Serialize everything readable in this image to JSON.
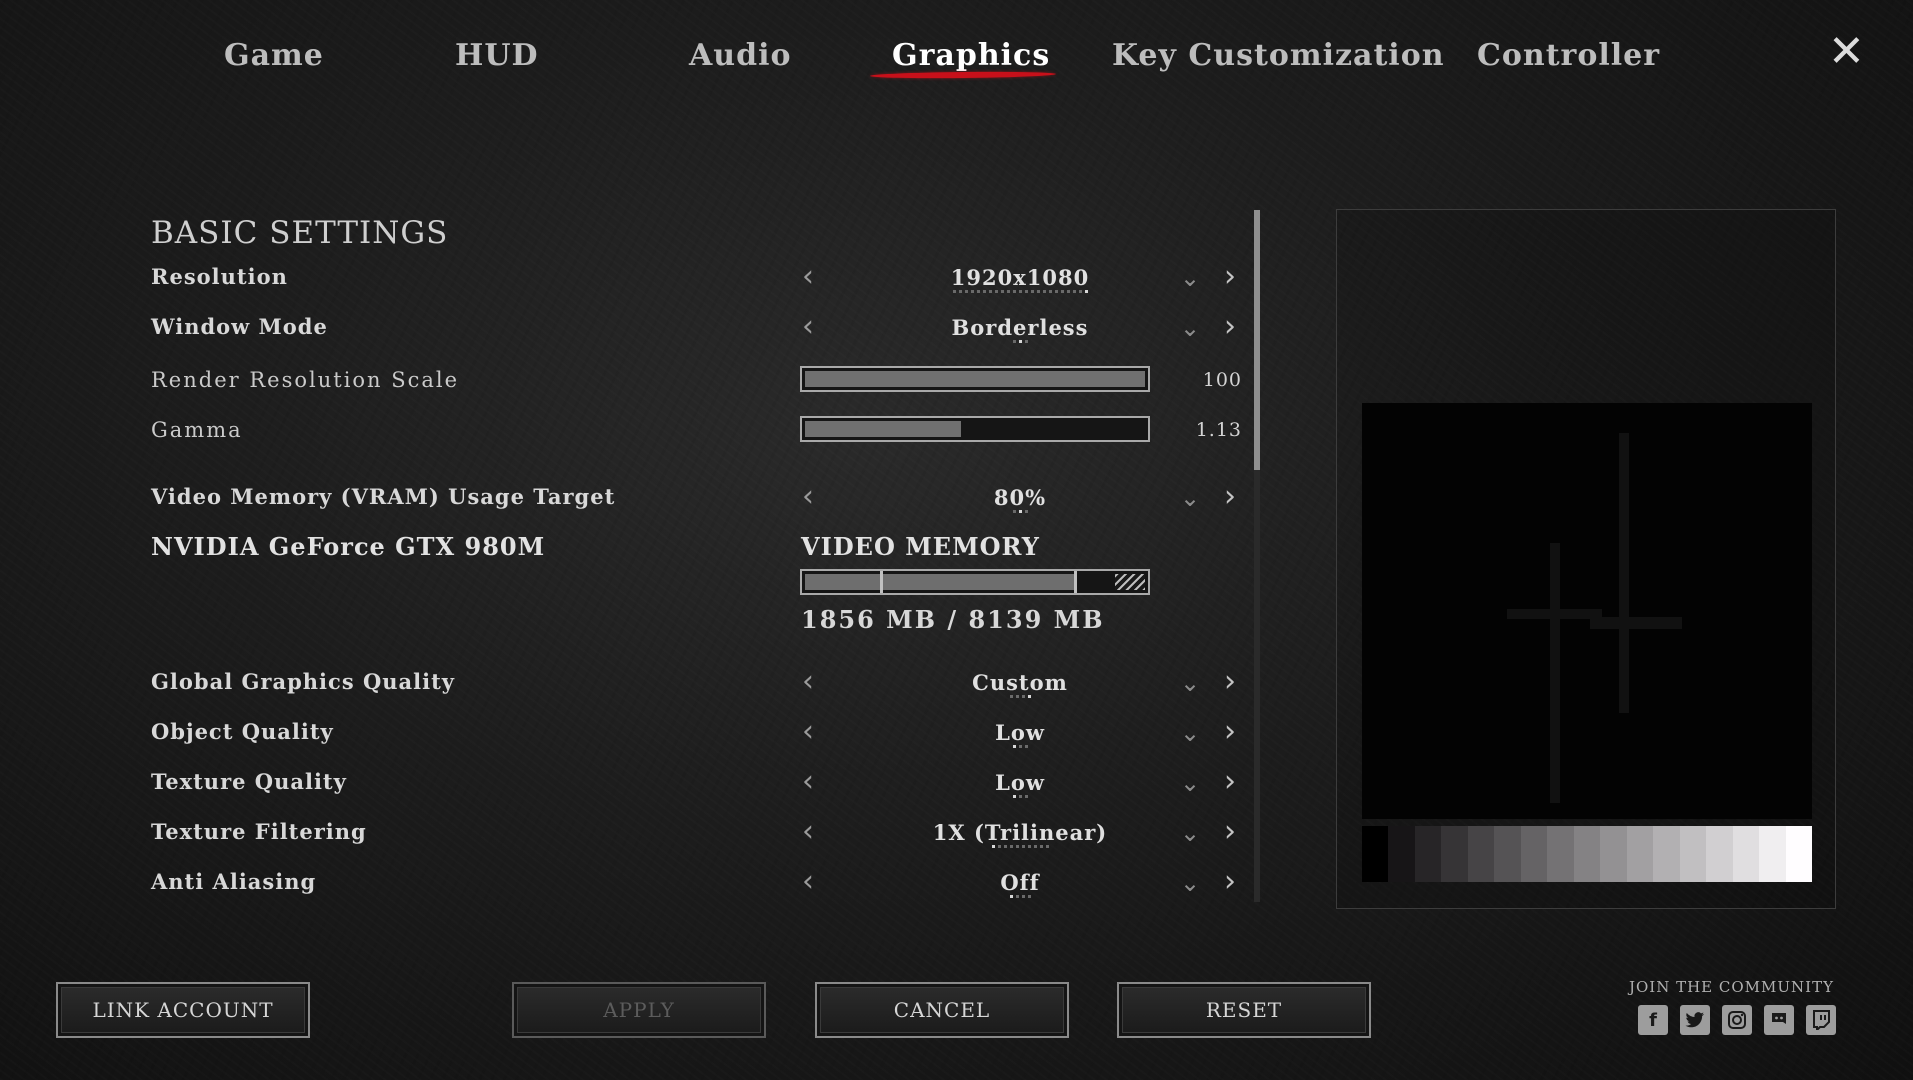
{
  "tabs": [
    {
      "label": "Game"
    },
    {
      "label": "HUD"
    },
    {
      "label": "Audio"
    },
    {
      "label": "Graphics",
      "active": true
    },
    {
      "label": "Key Customization"
    },
    {
      "label": "Controller"
    }
  ],
  "close_icon": "close-icon",
  "basic_settings": {
    "title": "BASIC SETTINGS",
    "resolution": {
      "label": "Resolution",
      "value": "1920x1080"
    },
    "window_mode": {
      "label": "Window Mode",
      "value": "Borderless"
    },
    "render_scale": {
      "label": "Render Resolution Scale",
      "value": "100",
      "level": 1.0
    },
    "gamma": {
      "label": "Gamma",
      "value": "1.13",
      "level": 0.46
    },
    "vram_target": {
      "label": "Video Memory (VRAM) Usage Target",
      "value": "80%"
    }
  },
  "gpu": {
    "name": "NVIDIA GeForce GTX 980M",
    "video_memory_title": "VIDEO MEMORY",
    "usage_text": "1856 MB / 8139 MB",
    "used_fraction": 0.23,
    "target_fraction": 0.8
  },
  "quality": {
    "global": {
      "label": "Global Graphics Quality",
      "value": "Custom"
    },
    "object": {
      "label": "Object Quality",
      "value": "Low"
    },
    "texture": {
      "label": "Texture Quality",
      "value": "Low"
    },
    "filtering": {
      "label": "Texture Filtering",
      "value": "1X (Trilinear)"
    },
    "anti_aliasing": {
      "label": "Anti Aliasing",
      "value": "Off"
    }
  },
  "buttons": {
    "link_account": "LINK ACCOUNT",
    "apply": "APPLY",
    "cancel": "CANCEL",
    "reset": "RESET"
  },
  "community": {
    "label": "JOIN THE COMMUNITY",
    "icons": [
      "facebook-icon",
      "twitter-icon",
      "instagram-icon",
      "discord-icon",
      "twitch-icon"
    ]
  },
  "colors": {
    "accent": "#c8101a",
    "background": "#1c1c1c"
  }
}
